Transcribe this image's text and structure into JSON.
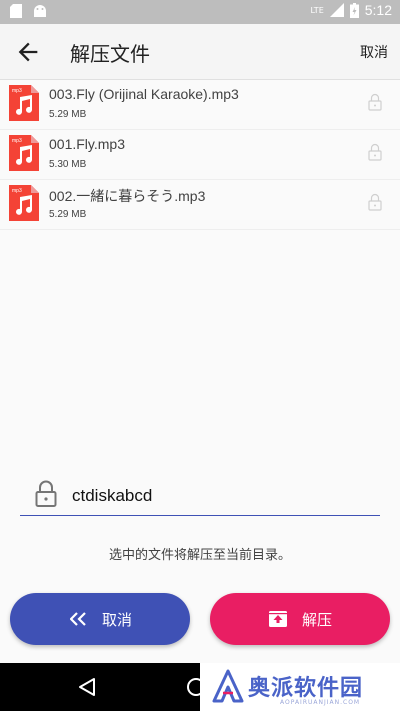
{
  "status_bar": {
    "time": "5:12",
    "network": "LTE"
  },
  "header": {
    "title": "解压文件",
    "cancel_label": "取消"
  },
  "files": [
    {
      "name": "003.Fly (Orijinal Karaoke).mp3",
      "size": "5.29 MB",
      "icon_label": "mp3"
    },
    {
      "name": "001.Fly.mp3",
      "size": "5.30 MB",
      "icon_label": "mp3"
    },
    {
      "name": "002.一緒に暮らそう.mp3",
      "size": "5.29 MB",
      "icon_label": "mp3"
    }
  ],
  "password": {
    "value": "ctdiskabcd"
  },
  "hint": "选中的文件将解压至当前目录。",
  "buttons": {
    "cancel": "取消",
    "extract": "解压"
  },
  "watermark": {
    "brand": "奥派软件园",
    "sub": "AOPAIRUANJIAN.COM"
  },
  "colors": {
    "primary": "#3f51b5",
    "accent": "#e91e63",
    "file_icon": "#f44336"
  }
}
